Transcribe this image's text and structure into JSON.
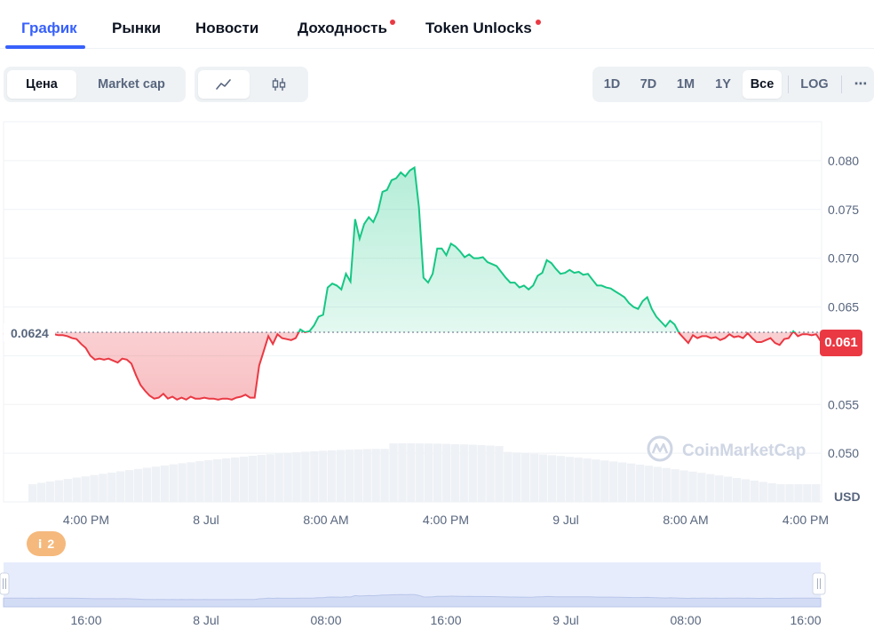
{
  "tabs": [
    {
      "label": "График",
      "active": true
    },
    {
      "label": "Рынки",
      "active": false
    },
    {
      "label": "Новости",
      "active": false
    },
    {
      "label": "Доходность",
      "active": false,
      "dot": true
    },
    {
      "label": "Token Unlocks",
      "active": false,
      "dot": true
    }
  ],
  "metric_toggle": {
    "price": "Цена",
    "market_cap": "Market cap",
    "selected": "Цена"
  },
  "chart_style_toggle": {
    "line_icon": "line-chart-icon",
    "candle_icon": "candlestick-icon",
    "selected": "line"
  },
  "ranges": {
    "d1": "1D",
    "d7": "7D",
    "m1": "1M",
    "y1": "1Y",
    "all": "Все",
    "log": "LOG",
    "more": "⋯",
    "selected": "Все"
  },
  "watermark": "CoinMarketCap",
  "currency": "USD",
  "badge": {
    "icon": "info-icon",
    "count": "2"
  },
  "colors": {
    "up": "#16c784",
    "down": "#ea3943",
    "accent": "#3861fb"
  },
  "chart_data": {
    "type": "line",
    "baseline_label": "0.0624",
    "baseline": 0.0624,
    "current_price_label": "0.061",
    "y_ticks": [
      "0.080",
      "0.075",
      "0.070",
      "0.065",
      "0.055",
      "0.050"
    ],
    "x_ticks": [
      "4:00 PM",
      "8 Jul",
      "8:00 AM",
      "4:00 PM",
      "9 Jul",
      "8:00 AM",
      "4:00 PM"
    ],
    "navigator_x_ticks": [
      "16:00",
      "8 Jul",
      "08:00",
      "16:00",
      "9 Jul",
      "08:00",
      "16:00"
    ],
    "ylim": [
      0.045,
      0.084
    ],
    "series": [
      {
        "values": [
          0.0623,
          0.0622,
          0.0623,
          0.0621,
          0.062,
          0.0618,
          0.0622,
          0.0617,
          0.062,
          0.0622,
          0.0621,
          0.0622,
          0.0621,
          0.0621,
          0.062,
          0.0618,
          0.0617,
          0.0612,
          0.0608,
          0.06,
          0.0596,
          0.0597,
          0.0596,
          0.0597,
          0.0595,
          0.0593,
          0.0597,
          0.0596,
          0.0592,
          0.058,
          0.057,
          0.0564,
          0.0559,
          0.0556,
          0.0557,
          0.0561,
          0.0556,
          0.0558,
          0.0555,
          0.0557,
          0.0555,
          0.0558,
          0.0556,
          0.0556,
          0.0557,
          0.0556,
          0.0556,
          0.0555,
          0.0556,
          0.0556,
          0.0555,
          0.0557,
          0.0558,
          0.056,
          0.0557,
          0.0557,
          0.059,
          0.0605,
          0.062,
          0.0612,
          0.0622,
          0.0618,
          0.0617,
          0.0616,
          0.0618,
          0.0627,
          0.0624,
          0.0625,
          0.0631,
          0.064,
          0.0642,
          0.067,
          0.0674,
          0.0672,
          0.0668,
          0.0684,
          0.0676,
          0.074,
          0.072,
          0.0735,
          0.0742,
          0.0737,
          0.0748,
          0.0768,
          0.077,
          0.078,
          0.0782,
          0.0788,
          0.0784,
          0.079,
          0.0793,
          0.0752,
          0.068,
          0.0675,
          0.0684,
          0.071,
          0.071,
          0.0703,
          0.0715,
          0.0712,
          0.0707,
          0.0701,
          0.0704,
          0.07,
          0.07,
          0.0701,
          0.0696,
          0.0694,
          0.0692,
          0.0686,
          0.068,
          0.0675,
          0.0675,
          0.067,
          0.0672,
          0.0668,
          0.0672,
          0.0682,
          0.0685,
          0.0698,
          0.0695,
          0.0689,
          0.0684,
          0.0685,
          0.0688,
          0.0685,
          0.0686,
          0.0683,
          0.0684,
          0.0678,
          0.0672,
          0.0672,
          0.067,
          0.0669,
          0.0666,
          0.0663,
          0.066,
          0.0654,
          0.065,
          0.0648,
          0.0656,
          0.066,
          0.0648,
          0.064,
          0.0635,
          0.063,
          0.0636,
          0.0632,
          0.0623,
          0.0618,
          0.0613,
          0.0621,
          0.0618,
          0.062,
          0.062,
          0.0618,
          0.0619,
          0.0616,
          0.0618,
          0.0622,
          0.0619,
          0.062,
          0.0618,
          0.0623,
          0.0618,
          0.0614,
          0.0614,
          0.0616,
          0.0618,
          0.0613,
          0.0611,
          0.0617,
          0.0618,
          0.0625,
          0.062,
          0.0622,
          0.0622,
          0.0621,
          0.0622,
          0.0615
        ]
      }
    ]
  }
}
